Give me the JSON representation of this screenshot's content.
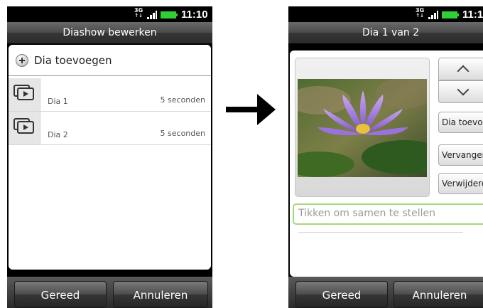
{
  "status": {
    "network": "3G",
    "time": "11:10"
  },
  "left_screen": {
    "title": "Diashow bewerken",
    "add_slide": "Dia toevoegen",
    "slides": [
      {
        "name": "Dia 1",
        "duration": "5 seconden"
      },
      {
        "name": "Dia 2",
        "duration": "5 seconden"
      }
    ],
    "buttons": {
      "done": "Gereed",
      "cancel": "Annuleren"
    }
  },
  "right_screen": {
    "title": "Dia 1 van 2",
    "side_buttons": {
      "add": "Dia toevoegen",
      "replace": "Vervangen",
      "remove": "Verwijderen"
    },
    "caption_placeholder": "Tikken om samen te stellen",
    "buttons": {
      "done": "Gereed",
      "cancel": "Annuleren"
    }
  },
  "colors": {
    "battery": "#2fcf35",
    "input_focus": "#a6d87a"
  }
}
